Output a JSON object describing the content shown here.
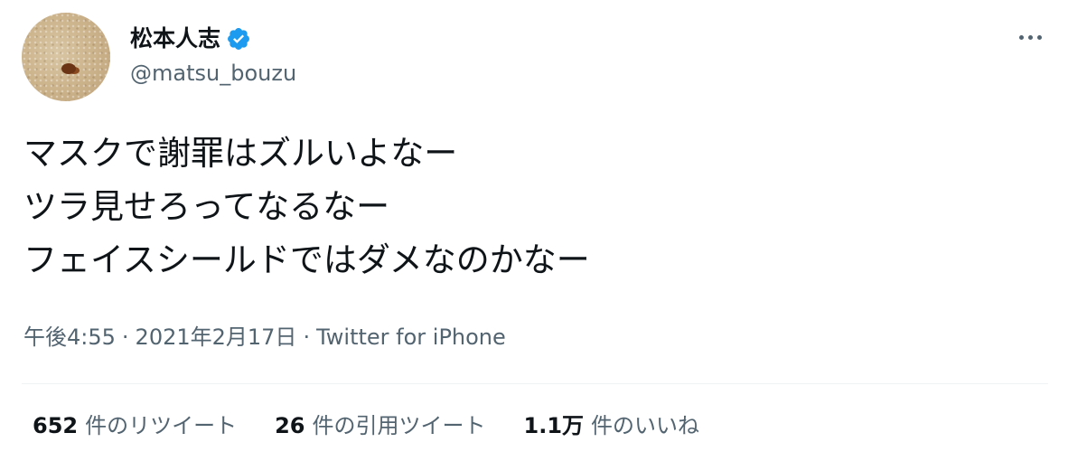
{
  "user": {
    "display_name": "松本人志",
    "handle": "@matsu_bouzu",
    "verified": true,
    "verified_color": "#1d9bf0"
  },
  "tweet": {
    "lines": [
      "マスクで謝罪はズルいよなー",
      "ツラ見せろってなるなー",
      "フェイスシールドではダメなのかなー"
    ],
    "time": "午後4:55",
    "date": "2021年2月17日",
    "source": "Twitter for iPhone",
    "separator": "·"
  },
  "stats": {
    "retweets": {
      "count": "652",
      "label": "件のリツイート"
    },
    "quotes": {
      "count": "26",
      "label": "件の引用ツイート"
    },
    "likes": {
      "count": "1.1万",
      "label": "件のいいね"
    }
  },
  "icons": {
    "verified": "verified-badge-icon",
    "more": "more-options-icon"
  }
}
